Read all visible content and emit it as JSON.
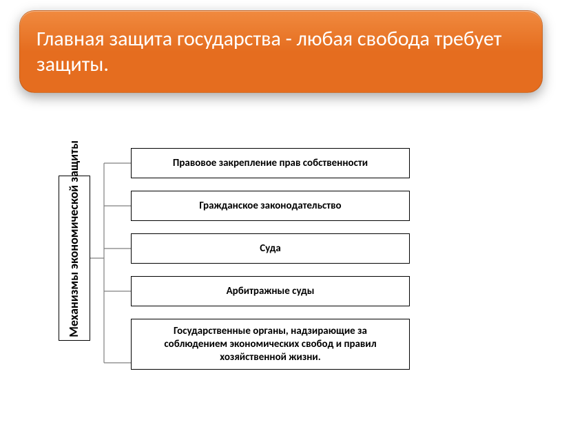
{
  "header": {
    "title": "Главная защита государства - любая свобода требует защиты."
  },
  "diagram": {
    "root": "Механизмы экономической защиты",
    "children": [
      "Правовое закрепление прав собственности",
      "Гражданское законодательство",
      "Суда",
      "Арбитражные суды",
      "Государственные органы, надзирающие за соблюдением экономических свобод и правил хозяйственной жизни."
    ]
  },
  "colors": {
    "accent": "#e56d1f",
    "connector": "#7f7f7f"
  }
}
